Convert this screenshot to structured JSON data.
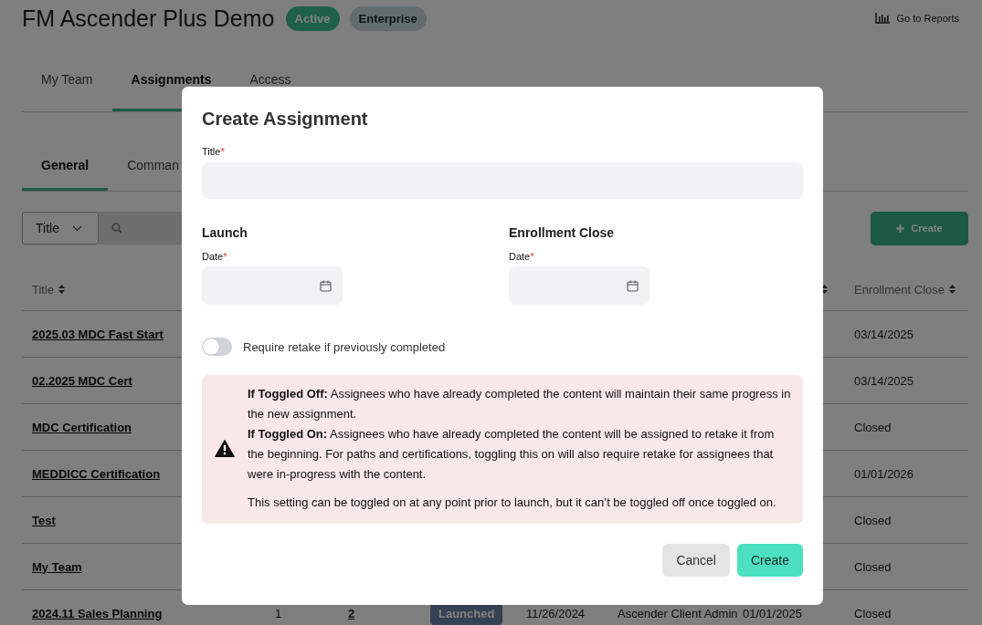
{
  "header": {
    "title": "FM Ascender Plus Demo",
    "badges": [
      {
        "label": "Active",
        "kind": "status"
      },
      {
        "label": "Enterprise",
        "kind": "plan"
      }
    ],
    "reports_link": "Go to Reports"
  },
  "tabs": [
    {
      "label": "My Team",
      "selected": false
    },
    {
      "label": "Assignments",
      "selected": true
    },
    {
      "label": "Access",
      "selected": false
    }
  ],
  "subtabs": [
    {
      "label": "General",
      "selected": true
    },
    {
      "label": "Comman",
      "selected": false
    }
  ],
  "filter": {
    "field": "Title"
  },
  "create_button": "Create",
  "table": {
    "title_column": "Title",
    "last_column": "Enrollment Close",
    "rows": [
      {
        "title": "2025.03 MDC Fast Start",
        "enrollment_close": "03/14/2025"
      },
      {
        "title": "02.2025 MDC Cert",
        "enrollment_close": "03/14/2025"
      },
      {
        "title": "MDC Certification",
        "enrollment_close": "Closed"
      },
      {
        "title": "MEDDICC Certification",
        "enrollment_close": "01/01/2026"
      },
      {
        "title": "Test",
        "enrollment_close": "Closed"
      },
      {
        "title": "My Team",
        "enrollment_close": "Closed"
      },
      {
        "title": "2024.11 Sales Planning",
        "column_2": "1",
        "column_3": "2",
        "column_4": "Launched",
        "column_5": "11/26/2024",
        "column_6": "Ascender Client Admin",
        "column_7": "01/01/2025",
        "enrollment_close": "Closed"
      }
    ]
  },
  "modal": {
    "title": "Create Assignment",
    "title_field": {
      "label": "Title",
      "required_mark": "*"
    },
    "sections": [
      {
        "heading": "Launch",
        "date_label": "Date",
        "required_mark": "*"
      },
      {
        "heading": "Enrollment Close",
        "date_label": "Date",
        "required_mark": "*"
      }
    ],
    "retake_toggle": {
      "label": "Require retake if previously completed",
      "on": false
    },
    "notice": {
      "paragraphs": [
        "**If Toggled Off:** Assignees who have already completed the content will maintain their same progress in the new assignment.",
        "**If Toggled On:** Assignees who have already completed the content will be assigned to retake it from the beginning. For paths and certifications, toggling this on will also require retake for assignees that were in-progress with the content.",
        "This setting can be toggled on at any point prior to launch, but it can’t be toggled off once toggled on."
      ]
    },
    "buttons": [
      {
        "label": "Cancel",
        "kind": "secondary"
      },
      {
        "label": "Create",
        "kind": "primary"
      }
    ]
  }
}
